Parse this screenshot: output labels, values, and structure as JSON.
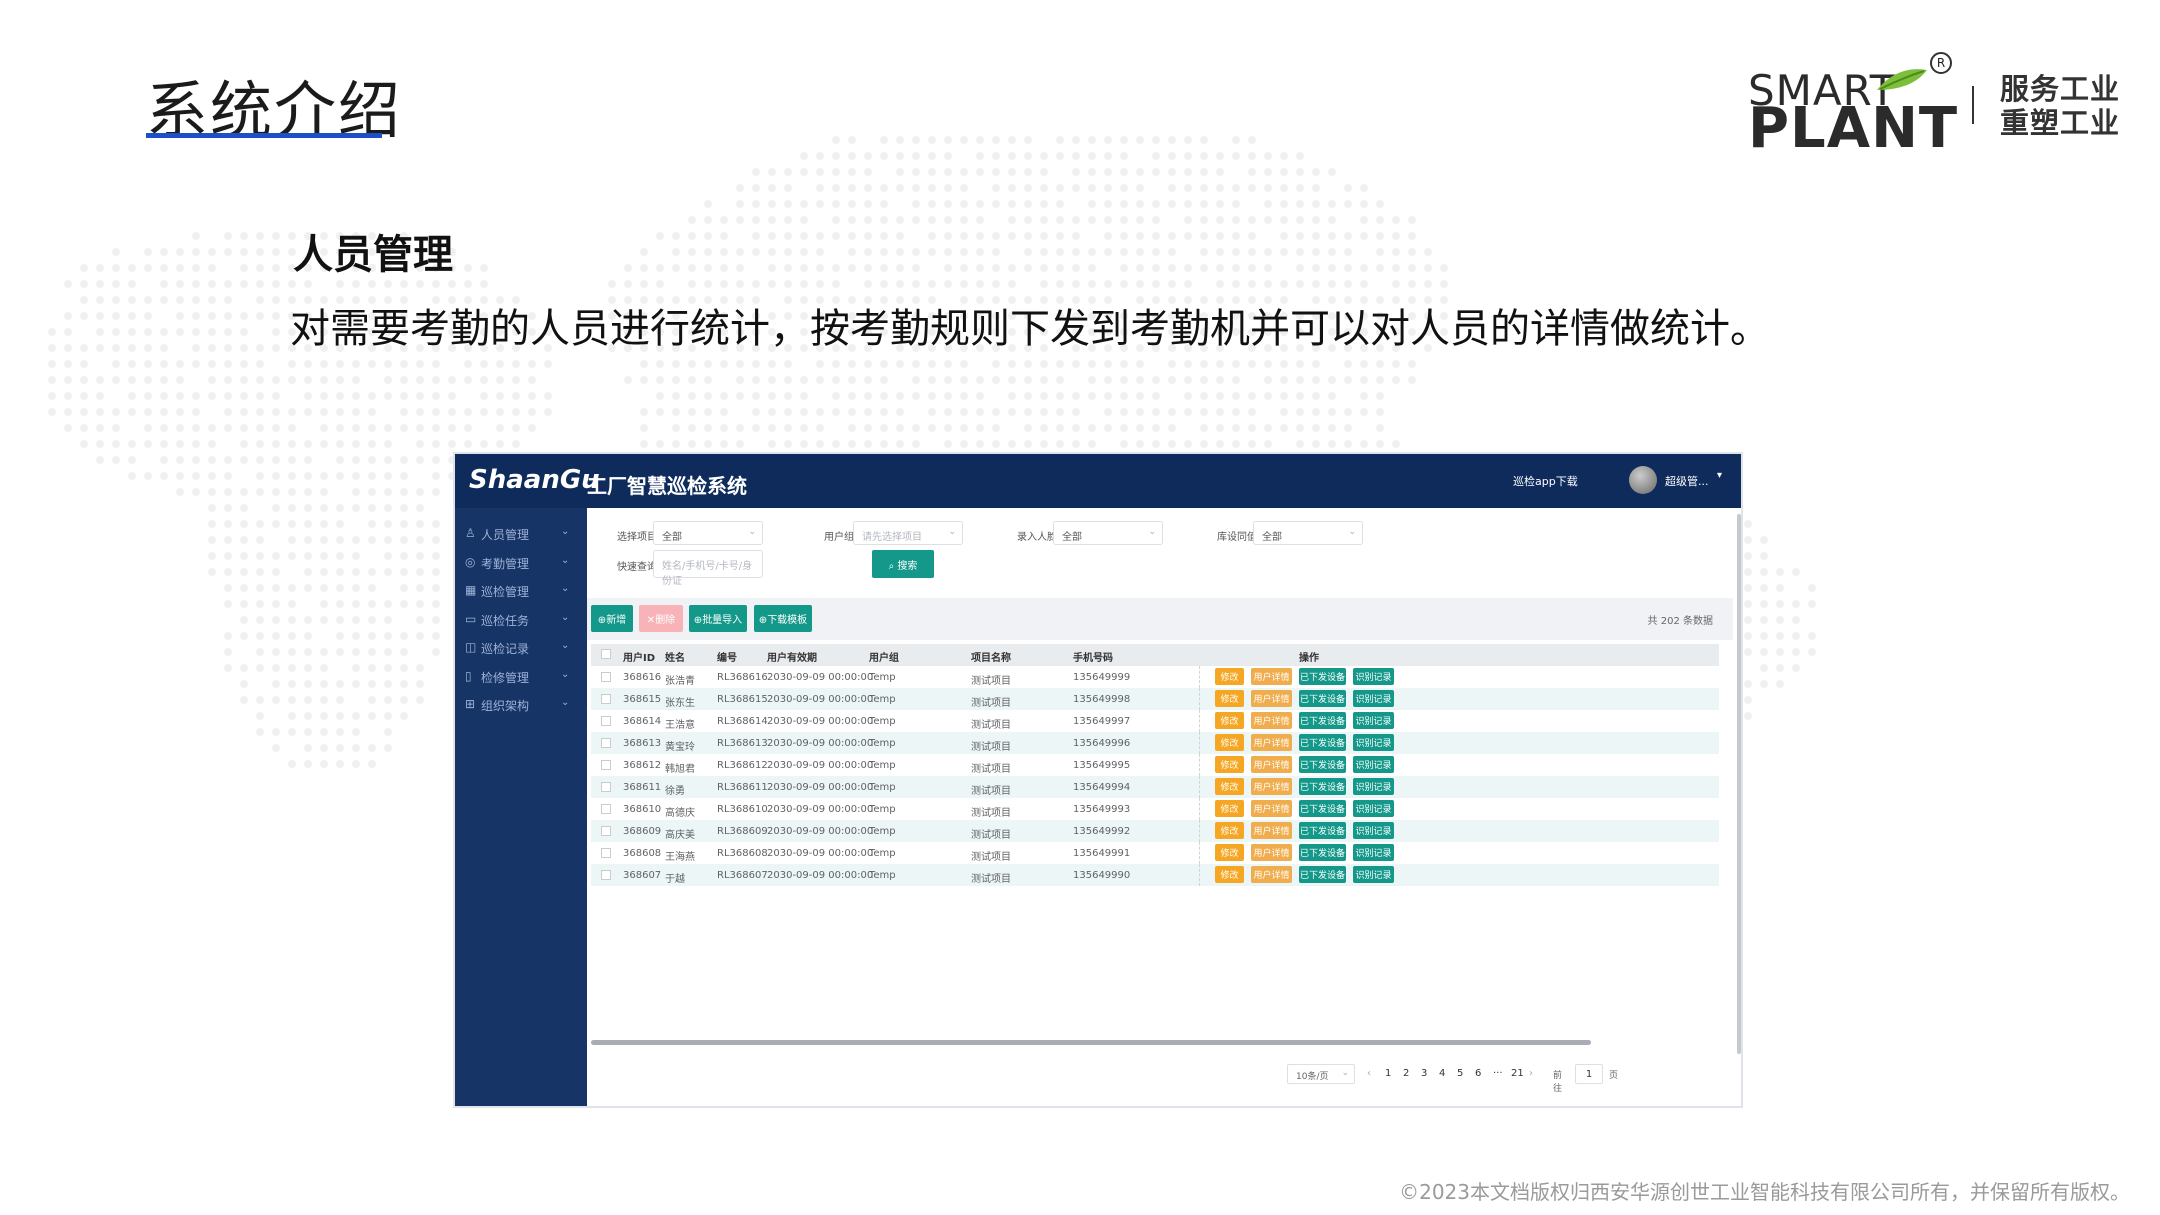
{
  "slide": {
    "title": "系统介绍",
    "logo": {
      "smart": "SMART",
      "plant": "PLANT",
      "registered": "R",
      "slogan_line1": "服务工业",
      "slogan_line2": "重塑工业"
    },
    "section_heading": "人员管理",
    "section_desc": "对需要考勤的人员进行统计，按考勤规则下发到考勤机并可以对人员的详情做统计。",
    "copyright": "©2023本文档版权归西安华源创世工业智能科技有限公司所有，并保留所有版权。",
    "accent_color": "#1c4fc9"
  },
  "app": {
    "brand_logo": "ShaanGu",
    "brand_name": "工厂智慧巡检系统",
    "download_link": "巡检app下载",
    "user_name": "超级管...",
    "colors": {
      "header": "#0e2b5c",
      "sidebar": "#163466",
      "primary": "#14988a",
      "warning": "#f5a623"
    },
    "sidebar": [
      {
        "icon": "user-icon",
        "glyph": "♙",
        "label": "人员管理"
      },
      {
        "icon": "attendance-icon",
        "glyph": "◎",
        "label": "考勤管理"
      },
      {
        "icon": "grid-icon",
        "glyph": "▦",
        "label": "巡检管理"
      },
      {
        "icon": "task-icon",
        "glyph": "▭",
        "label": "巡检任务"
      },
      {
        "icon": "record-icon",
        "glyph": "◫",
        "label": "巡检记录"
      },
      {
        "icon": "repair-icon",
        "glyph": "▯",
        "label": "检修管理"
      },
      {
        "icon": "org-icon",
        "glyph": "⊞",
        "label": "组织架构"
      }
    ],
    "filters": {
      "project_label": "选择项目",
      "project_value": "全部",
      "group_label": "用户组",
      "group_placeholder": "请先选择项目",
      "enroll_label": "录入人脸",
      "enroll_value": "全部",
      "sync_label": "库设同值",
      "sync_value": "全部",
      "quick_label": "快速查询",
      "quick_placeholder": "姓名/手机号/卡号/身份证",
      "search_button": "搜索"
    },
    "toolbar": {
      "add": "新增",
      "delete": "删除",
      "import": "批量导入",
      "download_template": "下载模板",
      "total": "共 202 条数据"
    },
    "table": {
      "headers": [
        "用户ID",
        "姓名",
        "编号",
        "用户有效期",
        "用户组",
        "项目名称",
        "手机号码",
        "操作"
      ],
      "actions": [
        "修改",
        "用户详情",
        "已下发设备",
        "识别记录"
      ],
      "rows": [
        [
          "368616",
          "张浩青",
          "RL368616",
          "2030-09-09 00:00:00",
          "Temp",
          "测试项目",
          "135649999"
        ],
        [
          "368615",
          "张东生",
          "RL368615",
          "2030-09-09 00:00:00",
          "Temp",
          "测试项目",
          "135649998"
        ],
        [
          "368614",
          "王浩意",
          "RL368614",
          "2030-09-09 00:00:00",
          "Temp",
          "测试项目",
          "135649997"
        ],
        [
          "368613",
          "黄宝玲",
          "RL368613",
          "2030-09-09 00:00:00",
          "Temp",
          "测试项目",
          "135649996"
        ],
        [
          "368612",
          "韩旭君",
          "RL368612",
          "2030-09-09 00:00:00",
          "Temp",
          "测试项目",
          "135649995"
        ],
        [
          "368611",
          "徐勇",
          "RL368611",
          "2030-09-09 00:00:00",
          "Temp",
          "测试项目",
          "135649994"
        ],
        [
          "368610",
          "高德庆",
          "RL368610",
          "2030-09-09 00:00:00",
          "Temp",
          "测试项目",
          "135649993"
        ],
        [
          "368609",
          "高庆美",
          "RL368609",
          "2030-09-09 00:00:00",
          "Temp",
          "测试项目",
          "135649992"
        ],
        [
          "368608",
          "王海燕",
          "RL368608",
          "2030-09-09 00:00:00",
          "Temp",
          "测试项目",
          "135649991"
        ],
        [
          "368607",
          "于越",
          "RL368607",
          "2030-09-09 00:00:00",
          "Temp",
          "测试项目",
          "135649990"
        ]
      ]
    },
    "pagination": {
      "page_size": "10条/页",
      "prev": "‹",
      "next": "›",
      "pages": [
        "1",
        "2",
        "3",
        "4",
        "5",
        "6",
        "···",
        "21"
      ],
      "goto_label": "前往",
      "goto_value": "1",
      "goto_suffix": "页"
    }
  }
}
